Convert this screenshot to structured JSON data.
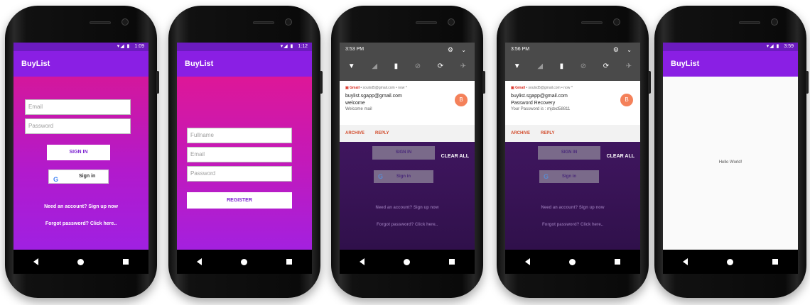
{
  "app_title": "BuyList",
  "nav_icons": [
    "back-triangle-icon",
    "home-circle-icon",
    "recents-square-icon"
  ],
  "colors": {
    "status_purple": "#6b1bbf",
    "appbar_purple": "#8a1fe4",
    "gradient_pink": "#e0168a",
    "gradient_violet": "#9a22e8",
    "avatar_orange": "#f4815a",
    "action_red": "#d14a2a"
  },
  "screens": {
    "login": {
      "status_time": "1:09",
      "email_placeholder": "Email",
      "password_placeholder": "Password",
      "sign_in_label": "SIGN IN",
      "google_label": "Sign in",
      "google_icon_glyph": "G",
      "signup_text": "Need an account? Sign up now",
      "forgot_text": "Forgot password? Click here.."
    },
    "register": {
      "status_time": "1:12",
      "fullname_placeholder": "Fullname",
      "email_placeholder": "Email",
      "password_placeholder": "Password",
      "register_label": "REGISTER"
    },
    "notif_welcome": {
      "shade_time": "3:53 PM",
      "gmail_label": "Gmail",
      "header_meta": " • soulxd5@gmail.com • now ^",
      "from": "buylist.sgapp@gmail.com",
      "subject": "welcome",
      "body": "Welcome mail",
      "avatar_letter": "B",
      "archive_label": "ARCHIVE",
      "reply_label": "REPLY",
      "clear_all": "CLEAR ALL",
      "bg_sign_in": "SIGN IN",
      "bg_google": "Sign in",
      "bg_signup": "Need an account? Sign up now",
      "bg_forgot": "Forgot password? Click here.."
    },
    "notif_recovery": {
      "shade_time": "3:56 PM",
      "gmail_label": "Gmail",
      "header_meta": " • soulxd5@gmail.com • now ^",
      "from": "buylist.sgapp@gmail.com",
      "subject": "Password Recovery",
      "body": "Your Password is : mjdxd58811",
      "avatar_letter": "B",
      "archive_label": "ARCHIVE",
      "reply_label": "REPLY",
      "clear_all": "CLEAR ALL",
      "bg_sign_in": "SIGN IN",
      "bg_google": "Sign in",
      "bg_signup": "Need an account? Sign up now",
      "bg_forgot": "Forgot password? Click here.."
    },
    "hello": {
      "status_time": "3:59",
      "hello_text": "Hello World!"
    }
  }
}
